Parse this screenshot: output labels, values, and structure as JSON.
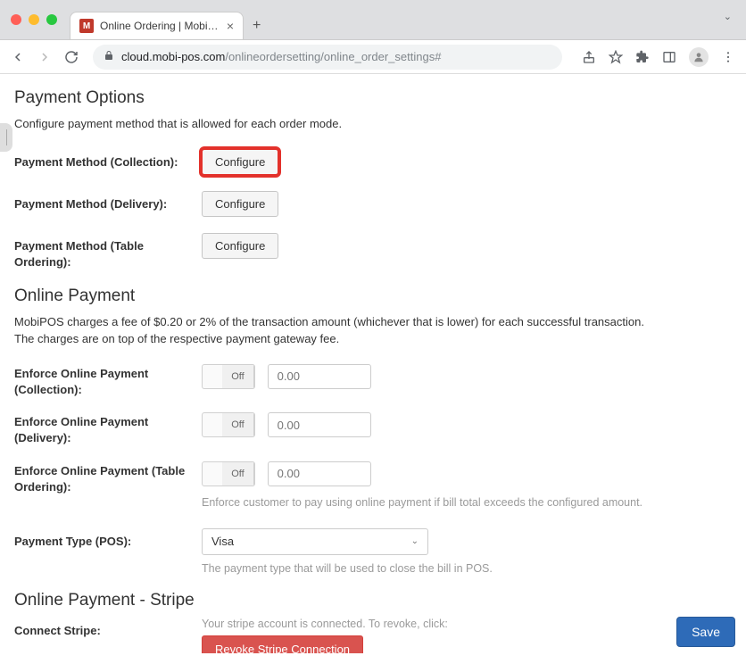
{
  "browser": {
    "tab": {
      "favicon_letter": "M",
      "title": "Online Ordering | MobiPOS"
    },
    "address": {
      "domain": "cloud.mobi-pos.com",
      "path": "/onlineordersetting/online_order_settings#"
    }
  },
  "payment_options": {
    "title": "Payment Options",
    "description": "Configure payment method that is allowed for each order mode.",
    "rows": {
      "collection": {
        "label": "Payment Method (Collection):",
        "button": "Configure"
      },
      "delivery": {
        "label": "Payment Method (Delivery):",
        "button": "Configure"
      },
      "table": {
        "label": "Payment Method (Table Ordering):",
        "button": "Configure"
      }
    }
  },
  "online_payment": {
    "title": "Online Payment",
    "desc_line1": "MobiPOS charges a fee of $0.20 or 2% of the transaction amount (whichever that is lower) for each successful transaction.",
    "desc_line2": "The charges are on top of the respective payment gateway fee.",
    "enforce": {
      "collection": {
        "label": "Enforce Online Payment (Collection):",
        "toggle": "Off",
        "placeholder": "0.00"
      },
      "delivery": {
        "label": "Enforce Online Payment (Delivery):",
        "toggle": "Off",
        "placeholder": "0.00"
      },
      "table": {
        "label": "Enforce Online Payment (Table Ordering):",
        "toggle": "Off",
        "placeholder": "0.00"
      },
      "help": "Enforce customer to pay using online payment if bill total exceeds the configured amount."
    },
    "payment_type": {
      "label": "Payment Type (POS):",
      "value": "Visa",
      "help": "The payment type that will be used to close the bill in POS."
    }
  },
  "stripe": {
    "title": "Online Payment - Stripe",
    "connect_label": "Connect Stripe:",
    "status": "Your stripe account is connected. To revoke, click:",
    "revoke_button": "Revoke Stripe Connection"
  },
  "save_label": "Save"
}
